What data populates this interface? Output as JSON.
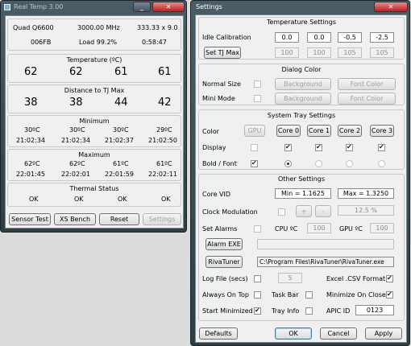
{
  "left": {
    "title": "Real Temp 3.00",
    "cpu": "Quad Q6600",
    "mhz": "3000.00 MHz",
    "ratio": "333.33 x 9.0",
    "id": "006FB",
    "load": "Load  99.2%",
    "time": "0:58:47",
    "temp_header": "Temperature (ºC)",
    "temps": [
      "62",
      "62",
      "61",
      "61"
    ],
    "dist_header": "Distance to TJ Max",
    "dists": [
      "38",
      "38",
      "44",
      "42"
    ],
    "min_header": "Minimum",
    "min_vals": [
      "30ºC",
      "30ºC",
      "30ºC",
      "29ºC"
    ],
    "min_times": [
      "21:02:34",
      "21:02:34",
      "21:02:37",
      "21:02:50"
    ],
    "max_header": "Maximum",
    "max_vals": [
      "62ºC",
      "62ºC",
      "61ºC",
      "61ºC"
    ],
    "max_times": [
      "22:01:45",
      "22:02:01",
      "22:01:59",
      "22:02:11"
    ],
    "status_header": "Thermal Status",
    "status": [
      "OK",
      "OK",
      "OK",
      "OK"
    ],
    "buttons": {
      "sensor": "Sensor Test",
      "xs": "XS Bench",
      "reset": "Reset",
      "settings": "Settings"
    }
  },
  "right": {
    "title": "Settings",
    "temp_group": "Temperature Settings",
    "idle_label": "Idle Calibration",
    "idle_vals": [
      "0.0",
      "0.0",
      "-0.5",
      "-2.5"
    ],
    "settj_btn": "Set TJ Max",
    "tj_vals": [
      "100",
      "100",
      "105",
      "105"
    ],
    "dialog_group": "Dialog Color",
    "normal_label": "Normal Size",
    "mini_label": "Mini Mode",
    "background": "Background",
    "font_color": "Font Color",
    "tray_group": "System Tray Settings",
    "color_label": "Color",
    "gpu_btn": "GPU",
    "cores": [
      "Core 0",
      "Core 1",
      "Core 2",
      "Core 3"
    ],
    "display_label": "Display",
    "bold_label": "Bold / Font",
    "other_group": "Other Settings",
    "corevid_label": "Core VID",
    "min_vid": "Min = 1.1625",
    "max_vid": "Max = 1.3250",
    "clock_label": "Clock Modulation",
    "plus": "+",
    "minus": "-",
    "clock_pct": "12.5 %",
    "alarms_label": "Set Alarms",
    "cpu_c": "CPU ºC",
    "cpu_alarm": "100",
    "gpu_c": "GPU ºC",
    "gpu_alarm": "100",
    "alarm_exe": "Alarm EXE",
    "rivatuner": "RivaTuner",
    "riva_path": "C:\\Program Files\\RivaTuner\\RivaTuner.exe",
    "log_label": "Log File (secs)",
    "log_val": "5",
    "excel_label": "Excel .CSV Format",
    "top_label": "Always On Top",
    "taskbar_label": "Task Bar",
    "minclose_label": "Minimize On Close",
    "startmin_label": "Start Minimized",
    "trayinfo_label": "Tray Info",
    "apic_label": "APIC ID",
    "apic_val": "0123",
    "defaults": "Defaults",
    "ok": "OK",
    "cancel": "Cancel",
    "apply": "Apply"
  }
}
